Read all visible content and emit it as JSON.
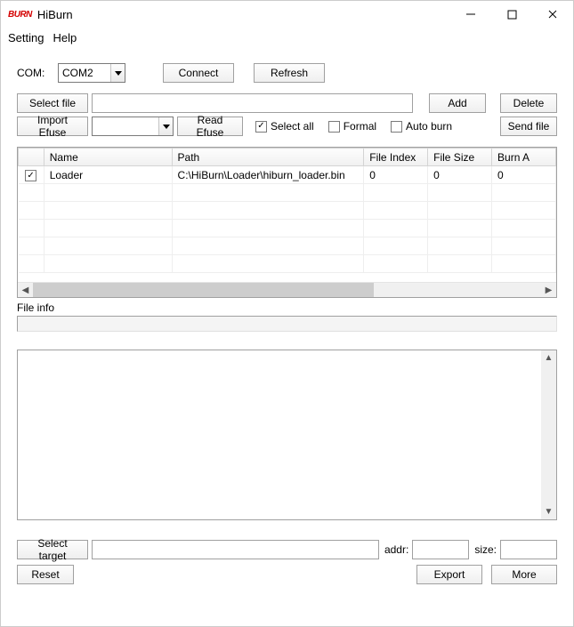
{
  "window": {
    "title": "HiBurn",
    "logo_text": "BURN",
    "menu": {
      "setting": "Setting",
      "help": "Help"
    }
  },
  "com_row": {
    "label": "COM:",
    "selected": "COM2",
    "connect": "Connect",
    "refresh": "Refresh"
  },
  "file_row": {
    "select_file": "Select file",
    "file_path": "",
    "add": "Add",
    "delete": "Delete"
  },
  "opts_row": {
    "import_efuse": "Import Efuse",
    "efuse_selected": "",
    "read_efuse": "Read Efuse",
    "select_all_label": "Select all",
    "select_all_checked": true,
    "formal_label": "Formal",
    "formal_checked": false,
    "auto_burn_label": "Auto burn",
    "auto_burn_checked": false,
    "send_file": "Send file"
  },
  "table": {
    "headers": {
      "check": "",
      "name": "Name",
      "path": "Path",
      "file_index": "File Index",
      "file_size": "File Size",
      "burn_addr": "Burn A"
    },
    "rows": [
      {
        "checked": true,
        "name": "Loader",
        "path": "C:\\HiBurn\\Loader\\hiburn_loader.bin",
        "file_index": "0",
        "file_size": "0",
        "burn_addr": "0"
      }
    ]
  },
  "file_info": {
    "label": "File info",
    "value": ""
  },
  "log": {
    "text": ""
  },
  "target_row": {
    "select_target": "Select target",
    "target_value": "",
    "addr_label": "addr:",
    "addr_value": "",
    "size_label": "size:",
    "size_value": ""
  },
  "bottom": {
    "reset": "Reset",
    "export": "Export",
    "more": "More"
  }
}
